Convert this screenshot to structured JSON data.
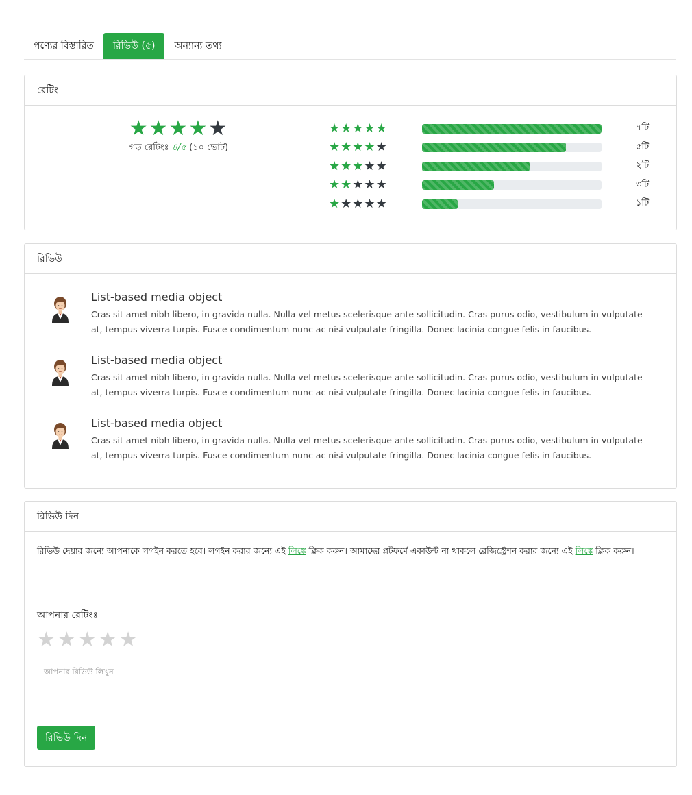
{
  "tabs": [
    {
      "label": "পণ্যের বিস্তারিত"
    },
    {
      "label": "রিভিউ (৫)"
    },
    {
      "label": "অন্যান্য তথ্য"
    }
  ],
  "rating_panel": {
    "title": "রেটিং",
    "average": {
      "stars_filled": 4,
      "stars_total": 5,
      "label_prefix": "গড় রেটিংঃ",
      "value": "৪/৫",
      "votes": "(১০ ভোট)"
    },
    "distribution": [
      {
        "stars": 5,
        "fill_percent": 100,
        "count": "৭টি"
      },
      {
        "stars": 4,
        "fill_percent": 80,
        "count": "৫টি"
      },
      {
        "stars": 3,
        "fill_percent": 60,
        "count": "২টি"
      },
      {
        "stars": 2,
        "fill_percent": 40,
        "count": "৩টি"
      },
      {
        "stars": 1,
        "fill_percent": 20,
        "count": "১টি"
      }
    ]
  },
  "reviews_panel": {
    "title": "রিভিউ",
    "items": [
      {
        "title": "List-based media object",
        "text": "Cras sit amet nibh libero, in gravida nulla. Nulla vel metus scelerisque ante sollicitudin. Cras purus odio, vestibulum in vulputate at, tempus viverra turpis. Fusce condimentum nunc ac nisi vulputate fringilla. Donec lacinia congue felis in faucibus."
      },
      {
        "title": "List-based media object",
        "text": "Cras sit amet nibh libero, in gravida nulla. Nulla vel metus scelerisque ante sollicitudin. Cras purus odio, vestibulum in vulputate at, tempus viverra turpis. Fusce condimentum nunc ac nisi vulputate fringilla. Donec lacinia congue felis in faucibus."
      },
      {
        "title": "List-based media object",
        "text": "Cras sit amet nibh libero, in gravida nulla. Nulla vel metus scelerisque ante sollicitudin. Cras purus odio, vestibulum in vulputate at, tempus viverra turpis. Fusce condimentum nunc ac nisi vulputate fringilla. Donec lacinia congue felis in faucibus."
      }
    ]
  },
  "write_panel": {
    "title": "রিভিউ দিন",
    "note_part1": "রিভিউ দেয়ার জন্যে আপনাকে লগইন করতে হবে। লগইন করার জন্যে এই ",
    "link1": "লিঙ্কে",
    "note_part2": " ক্লিক করুন। আমাদের প্লটফর্মে একাউন্ট না থাকলে রেজিস্ট্রেশন করার জন্যে এই ",
    "link2": "লিঙ্কে",
    "note_part3": " ক্লিক করুন।",
    "your_rating_label": "আপনার রেটিংঃ",
    "input_stars": 5,
    "textarea_placeholder": "আপনার রিভিউ লিখুন",
    "submit_label": "রিভিউ দিন"
  },
  "colors": {
    "accent": "#28a745",
    "star_off": "#343a40",
    "star_input": "#d3d3d3"
  }
}
